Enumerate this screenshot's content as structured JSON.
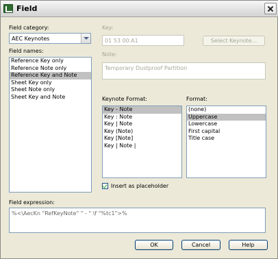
{
  "window": {
    "title": "Field"
  },
  "field_category": {
    "label": "Field category:",
    "selected": "AEC Keynotes"
  },
  "field_names": {
    "label": "Field names:",
    "items": [
      "Reference Key only",
      "Reference Note only",
      "Reference Key and Note",
      "Sheet Key only",
      "Sheet Note only",
      "Sheet Key and Note"
    ],
    "selected_index": 2
  },
  "key": {
    "label": "Key:",
    "value": "01 53 00.A1"
  },
  "select_keynote_button": "Select Keynote...",
  "note": {
    "label": "Note:",
    "value": "Temporary Dustproof Partition"
  },
  "keynote_format": {
    "label": "Keynote Format:",
    "items": [
      "Key - Note",
      "Key : Note",
      "Key | Note",
      "Key (Note)",
      "Key [Note]",
      "Key | Note |"
    ],
    "selected_index": 0
  },
  "format": {
    "label": "Format:",
    "items": [
      "(none)",
      "Uppercase",
      "Lowercase",
      "First capital",
      "Title case"
    ],
    "selected_index": 1
  },
  "insert_as_placeholder": {
    "label": "Insert as placeholder",
    "checked": true
  },
  "field_expression": {
    "label": "Field expression:",
    "value": "%<\\AecKn \"RefKeyNote\" \" - \" \\f \"%tc1\">%"
  },
  "buttons": {
    "ok": "OK",
    "cancel": "Cancel",
    "help": "Help"
  }
}
